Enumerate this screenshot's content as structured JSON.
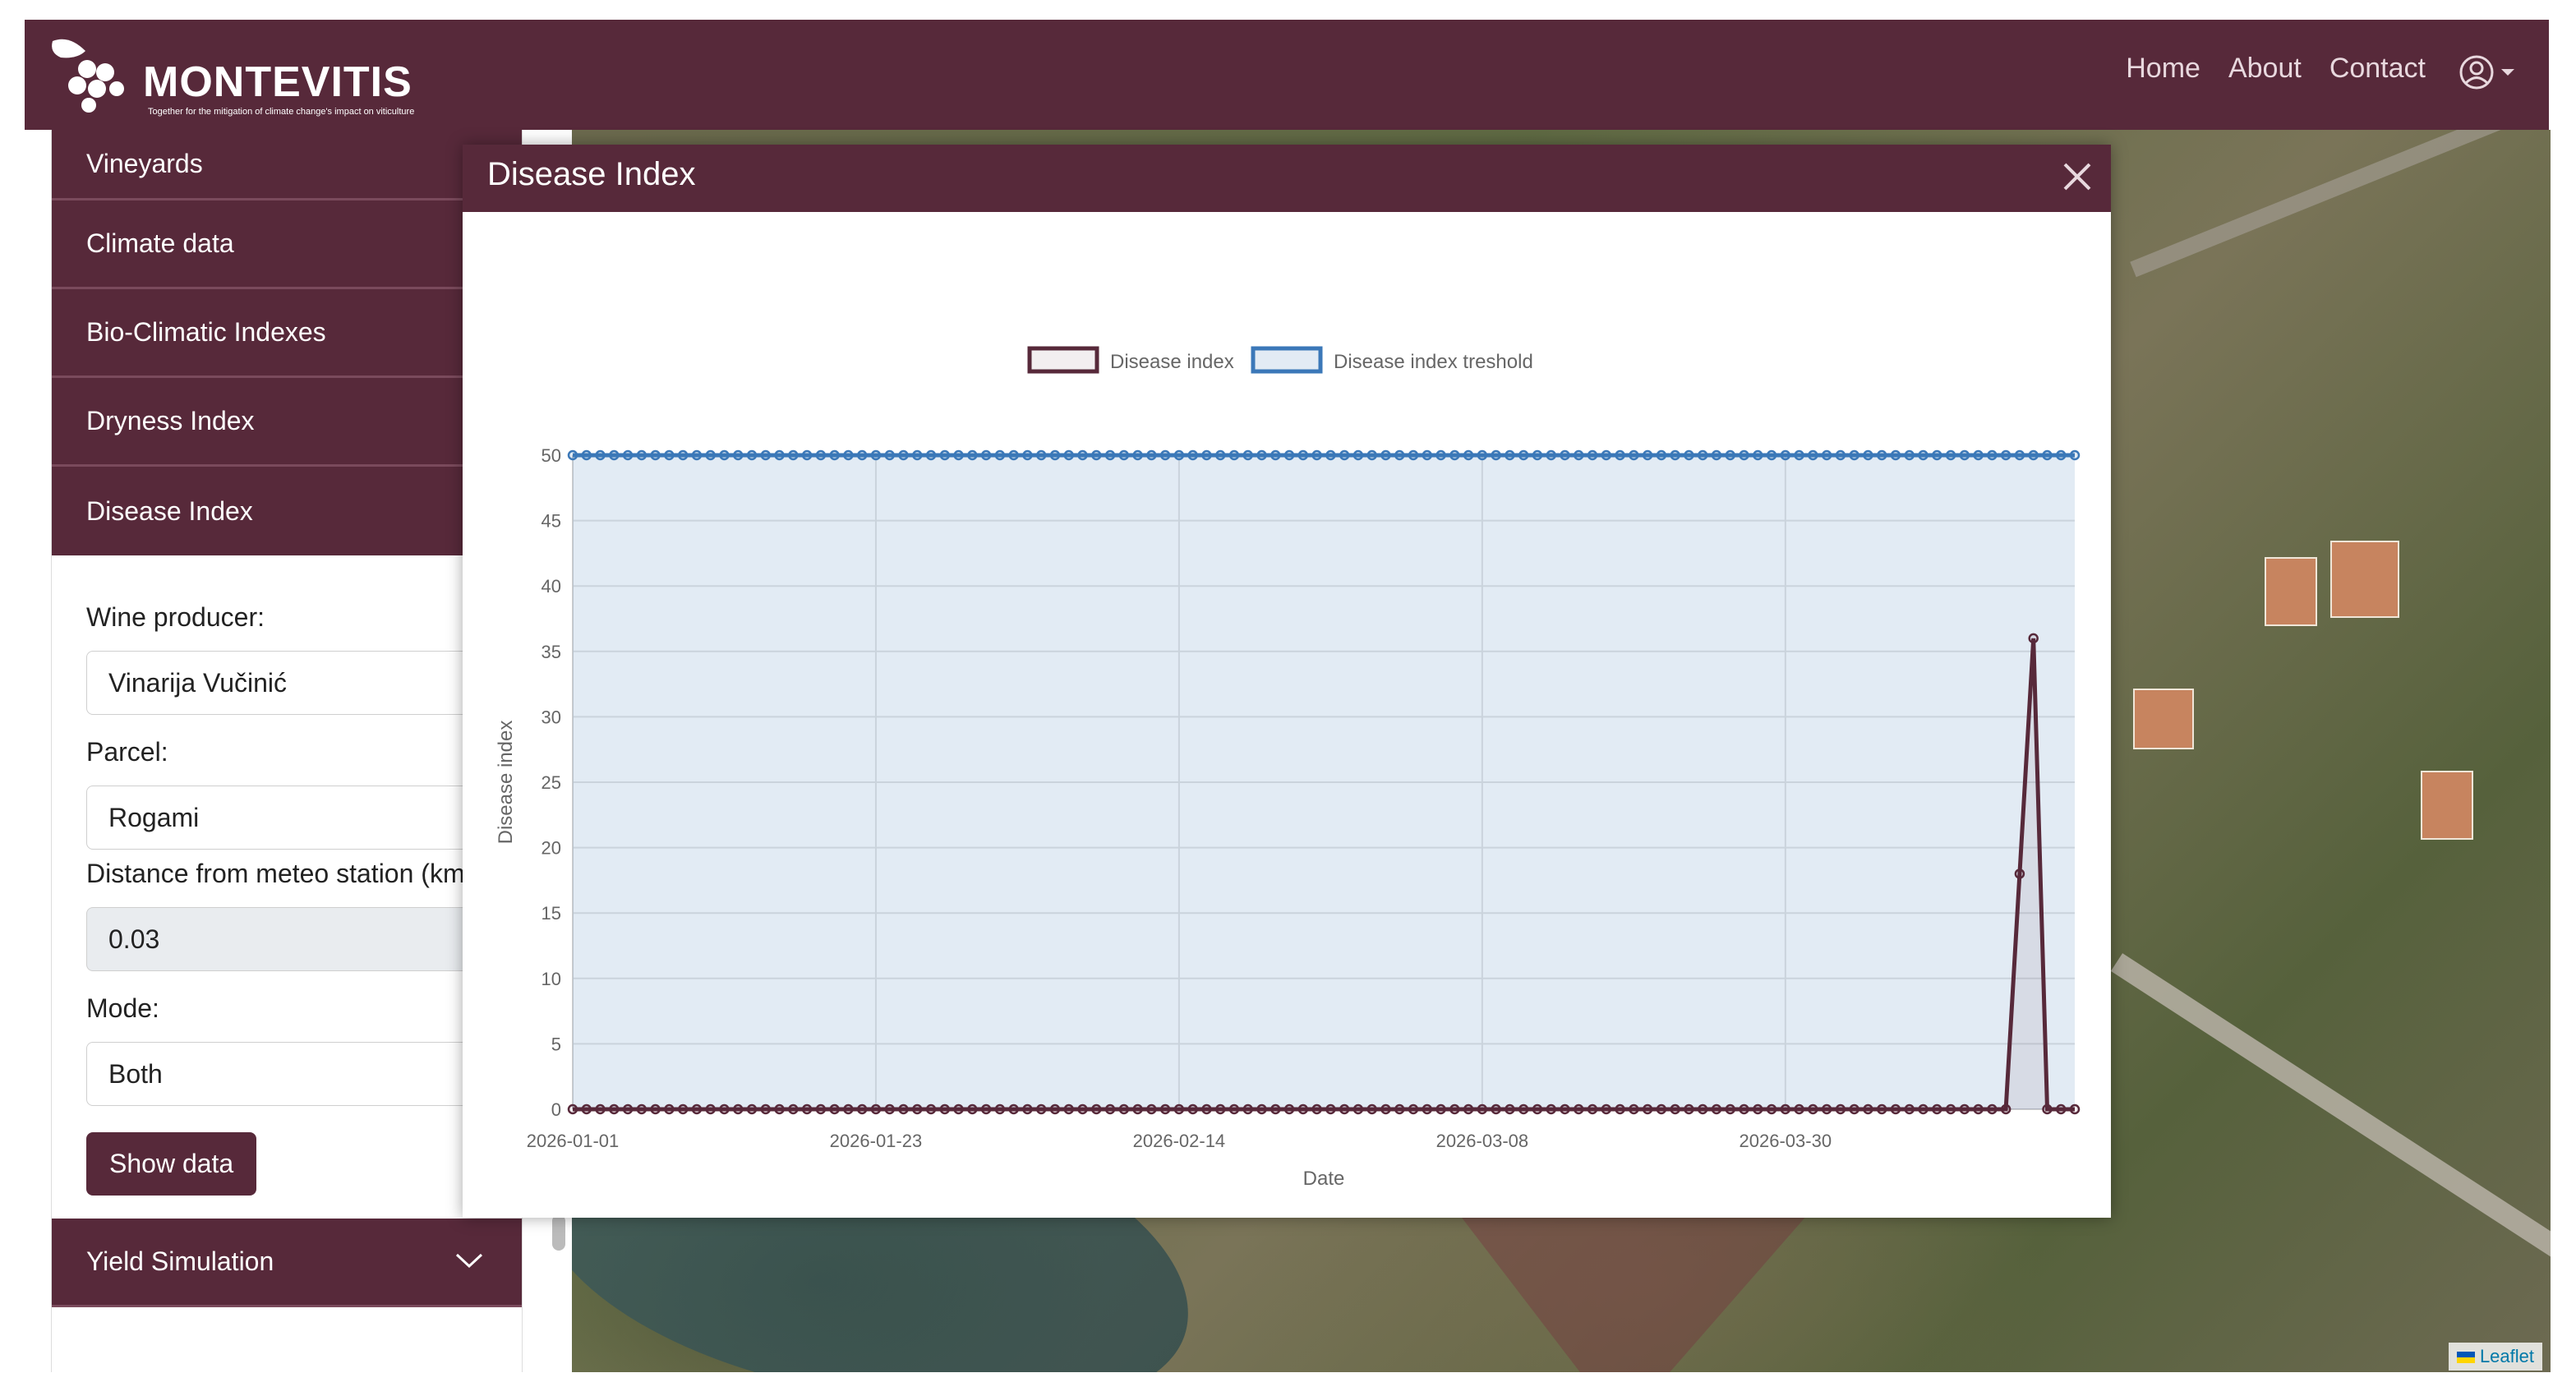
{
  "navbar": {
    "brand": "MONTEVITIS",
    "tagline": "Together for the mitigation of climate change's impact on viticulture",
    "links": [
      "Home",
      "About",
      "Contact"
    ]
  },
  "sidebar": {
    "sections": [
      "Vineyards",
      "Climate data",
      "Bio-Climatic Indexes",
      "Dryness Index",
      "Disease Index"
    ],
    "form": {
      "producer_label": "Wine producer:",
      "producer_value": "Vinarija Vučinić",
      "parcel_label": "Parcel:",
      "parcel_value": "Rogami",
      "distance_label": "Distance from meteo station (km):",
      "distance_value": "0.03",
      "mode_label": "Mode:",
      "mode_value": "Both",
      "show_button": "Show data"
    },
    "last_section": "Yield Simulation"
  },
  "map": {
    "attribution": "Leaflet"
  },
  "modal": {
    "title": "Disease Index"
  },
  "chart_data": {
    "type": "line",
    "xlabel": "Date",
    "ylabel": "Disease index",
    "ylim": [
      0,
      50
    ],
    "yticks": [
      0,
      5,
      10,
      15,
      20,
      25,
      30,
      35,
      40,
      45,
      50
    ],
    "x_start": "2026-01-01",
    "x_end": "2026-04-20",
    "xticks": [
      "2026-01-01",
      "2026-01-23",
      "2026-02-14",
      "2026-03-08",
      "2026-03-30"
    ],
    "grid": true,
    "legend_position": "top",
    "series": [
      {
        "name": "Disease index",
        "color": "#57293a",
        "fill": "rgba(87,41,58,0.08)",
        "default": 0,
        "points": [
          [
            "2026-04-16",
            18
          ],
          [
            "2026-04-17",
            36
          ],
          [
            "2026-04-18",
            0
          ]
        ]
      },
      {
        "name": "Disease index treshold",
        "color": "#3b78b8",
        "fill": "rgba(59,120,184,0.15)",
        "default": 50,
        "points": []
      }
    ]
  },
  "colors": {
    "brand": "#57293a"
  }
}
